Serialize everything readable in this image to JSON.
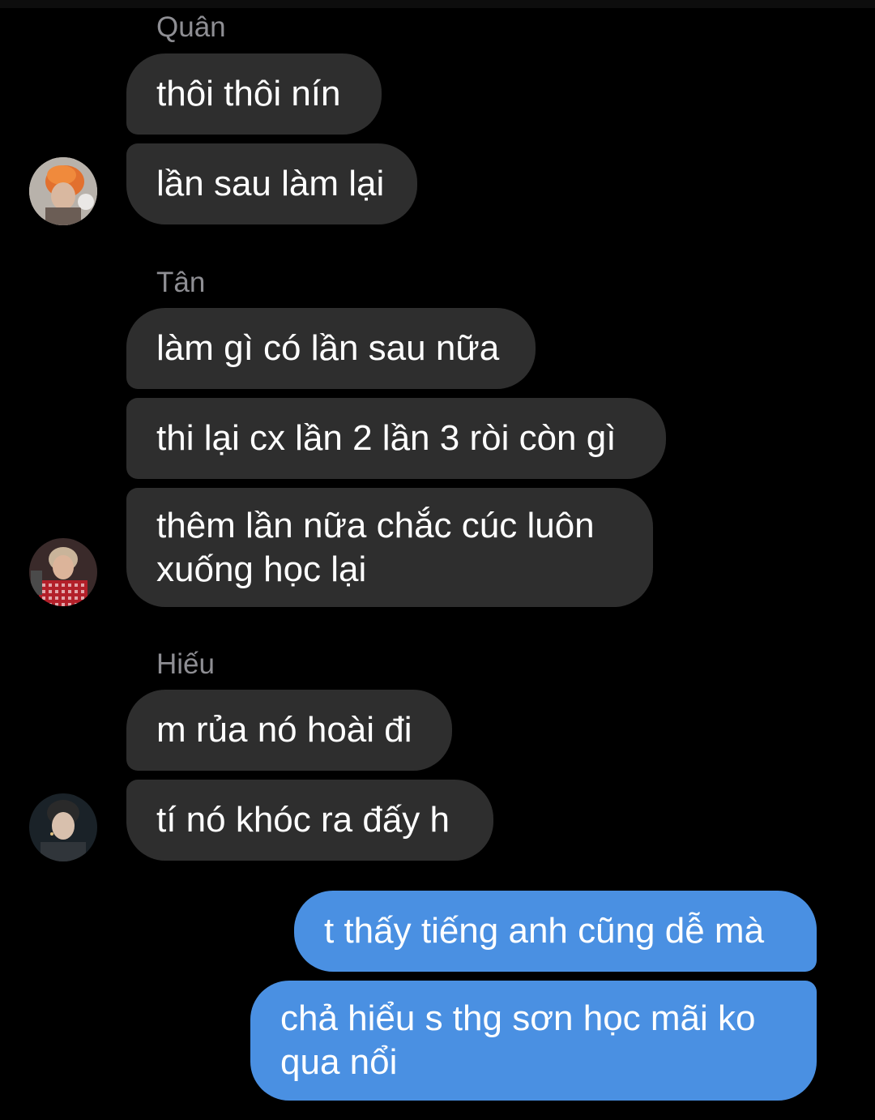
{
  "conversation": {
    "groups": [
      {
        "sender": "Quân",
        "messages": [
          "thôi thôi nín",
          "lần sau làm lại"
        ],
        "avatar_icon": "avatar-quan-icon"
      },
      {
        "sender": "Tân",
        "messages": [
          "làm gì có lần sau nữa",
          "thi lại cx lần 2 lần 3 ròi còn gì",
          "thêm lần nữa chắc cúc luôn",
          "xuống học lại"
        ],
        "avatar_icon": "avatar-tan-icon"
      },
      {
        "sender": "Hiếu",
        "messages": [
          "m rủa nó hoài đi",
          "tí nó khóc ra đấy h"
        ],
        "avatar_icon": "avatar-hieu-icon"
      }
    ],
    "outgoing": [
      "t thấy tiếng anh cũng dễ mà",
      "chả hiểu s thg sơn học mãi ko",
      "qua nổi"
    ]
  },
  "colors": {
    "background": "#000000",
    "incoming_bubble": "#2e2e2e",
    "outgoing_bubble": "#4a90e2",
    "sender_name": "#8e8e93"
  }
}
